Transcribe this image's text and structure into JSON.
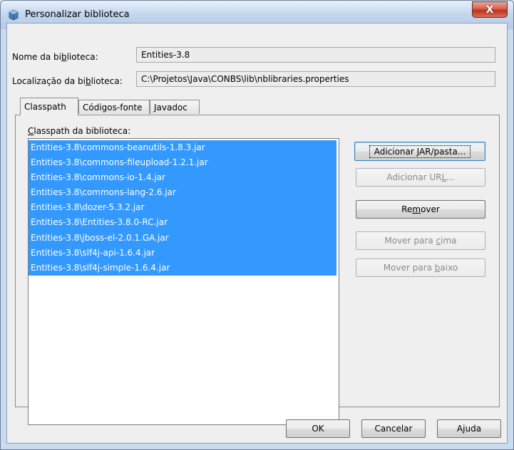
{
  "window": {
    "title": "Personalizar biblioteca",
    "close_label": "X"
  },
  "fields": {
    "name_label_pre": "Nome da bi",
    "name_label_mn": "b",
    "name_label_post": "lioteca:",
    "name_value": "Entities-3.8",
    "location_label_pre": "Localização da bi",
    "location_label_mn": "b",
    "location_label_post": "lioteca:",
    "location_value": "C:\\Projetos\\Java\\CONBS\\lib\\nblibraries.properties"
  },
  "tabs": [
    {
      "label": "Classpath"
    },
    {
      "label": "Códigos-fonte"
    },
    {
      "label": "Javadoc"
    }
  ],
  "classpath": {
    "label_mn": "C",
    "label_rest": "lasspath da biblioteca:",
    "items": [
      "Entities-3.8\\commons-beanutils-1.8.3.jar",
      "Entities-3.8\\commons-fileupload-1.2.1.jar",
      "Entities-3.8\\commons-io-1.4.jar",
      "Entities-3.8\\commons-lang-2.6.jar",
      "Entities-3.8\\dozer-5.3.2.jar",
      "Entities-3.8\\Entities-3.8.0-RC.jar",
      "Entities-3.8\\jboss-el-2.0.1.GA.jar",
      "Entities-3.8\\slf4j-api-1.6.4.jar",
      "Entities-3.8\\slf4j-simple-1.6.4.jar"
    ]
  },
  "side_buttons": {
    "add_jar_pre": "Adicionar ",
    "add_jar_mn": "J",
    "add_jar_post": "AR/pasta...",
    "add_url_pre": "Adicionar UR",
    "add_url_mn": "L",
    "add_url_post": "...",
    "remove_pre": "Re",
    "remove_mn": "m",
    "remove_post": "over",
    "move_up_pre": "Mover para ",
    "move_up_mn": "c",
    "move_up_post": "ima",
    "move_down_pre": "Mover para ",
    "move_down_mn": "b",
    "move_down_post": "aixo"
  },
  "footer": {
    "ok": "OK",
    "cancel": "Cancelar",
    "help_pre": "A",
    "help_mn": "j",
    "help_post": "uda"
  }
}
